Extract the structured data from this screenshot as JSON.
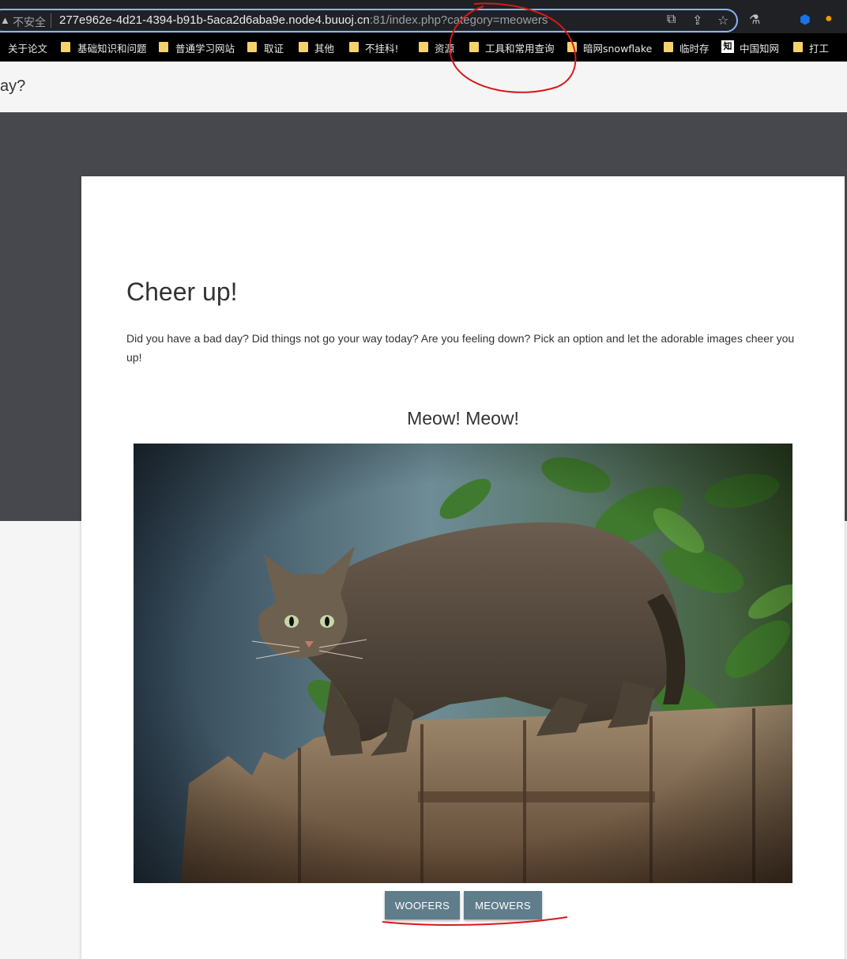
{
  "browser": {
    "insecure_label": "不安全",
    "url_main": "277e962e-4d21-4394-b91b-5aca2d6aba9e.node4.buuoj.cn",
    "url_rest": ":81/index.php?category=meowers"
  },
  "bookmarks": [
    {
      "label": "关于论文",
      "type": "folder"
    },
    {
      "label": "基础知识和问题",
      "type": "folder"
    },
    {
      "label": "普通学习网站",
      "type": "folder"
    },
    {
      "label": "取证",
      "type": "folder"
    },
    {
      "label": "其他",
      "type": "folder"
    },
    {
      "label": "不挂科!",
      "type": "folder"
    },
    {
      "label": "资源",
      "type": "folder"
    },
    {
      "label": "工具和常用查询",
      "type": "folder"
    },
    {
      "label": "暗网snowflake",
      "type": "folder"
    },
    {
      "label": "临时存",
      "type": "folder"
    },
    {
      "label": "中国知网",
      "type": "site"
    },
    {
      "label": "打工",
      "type": "folder"
    }
  ],
  "page": {
    "nav_title_fragment": "ay?",
    "heading": "Cheer up!",
    "intro": "Did you have a bad day? Did things not go your way today? Are you feeling down? Pick an option and let the adorable images cheer you up!",
    "subheading": "Meow! Meow!",
    "buttons": {
      "woofers": "WOOFERS",
      "meowers": "MEOWERS"
    }
  },
  "colors": {
    "accent_button": "#607d8b",
    "hero_bg": "#47484d",
    "annotation": "#d7191c"
  }
}
